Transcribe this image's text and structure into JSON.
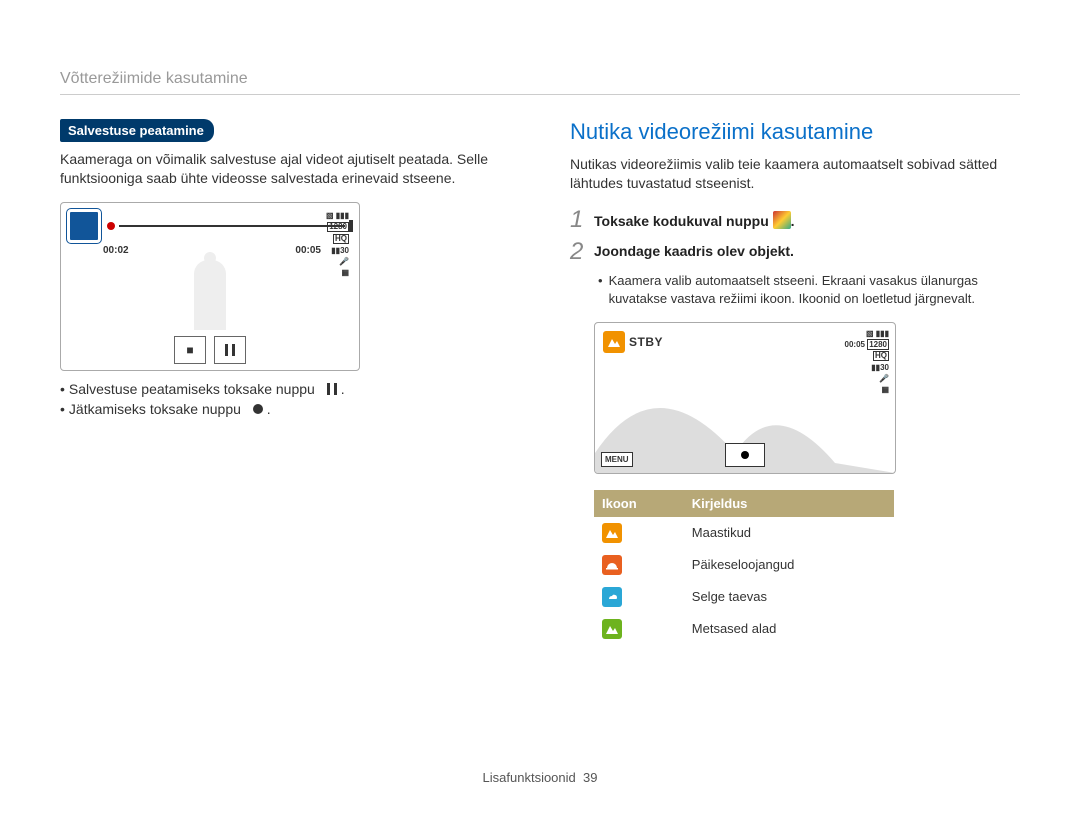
{
  "breadcrumb": "Võtterežiimide kasutamine",
  "left": {
    "tag": "Salvestuse peatamine",
    "paragraph": "Kaameraga on võimalik salvestuse ajal videot ajutiselt peatada. Selle funktsiooniga saab ühte videosse salvestada erinevaid stseene.",
    "time_elapsed": "00:02",
    "time_total": "00:05",
    "res_badge1": "1280",
    "res_badge2": "HQ",
    "fps_badge": "30",
    "bullet1": "Salvestuse peatamiseks toksake nuppu",
    "bullet2": "Jätkamiseks toksake nuppu"
  },
  "right": {
    "heading": "Nutika videorežiimi kasutamine",
    "paragraph": "Nutikas videorežiimis valib teie kaamera automaatselt sobivad sätted lähtudes tuvastatud stseenist.",
    "step1": "Toksake kodukuval nuppu",
    "step2": "Joondage kaadris olev objekt.",
    "step2_sub": "Kaamera valib automaatselt stseeni. Ekraani vasakus ülanurgas kuvatakse vastava režiimi ikoon. Ikoonid on loetletud järgnevalt.",
    "stby": "STBY",
    "stby_time": "00:05",
    "menu_label": "MENU",
    "table": {
      "h_icon": "Ikoon",
      "h_desc": "Kirjeldus",
      "rows": [
        {
          "color": "c-orange",
          "label": "Maastikud"
        },
        {
          "color": "c-red",
          "label": "Päikeseloojangud"
        },
        {
          "color": "c-blue",
          "label": "Selge taevas"
        },
        {
          "color": "c-green",
          "label": "Metsased alad"
        }
      ]
    }
  },
  "footer_label": "Lisafunktsioonid",
  "footer_page": "39"
}
